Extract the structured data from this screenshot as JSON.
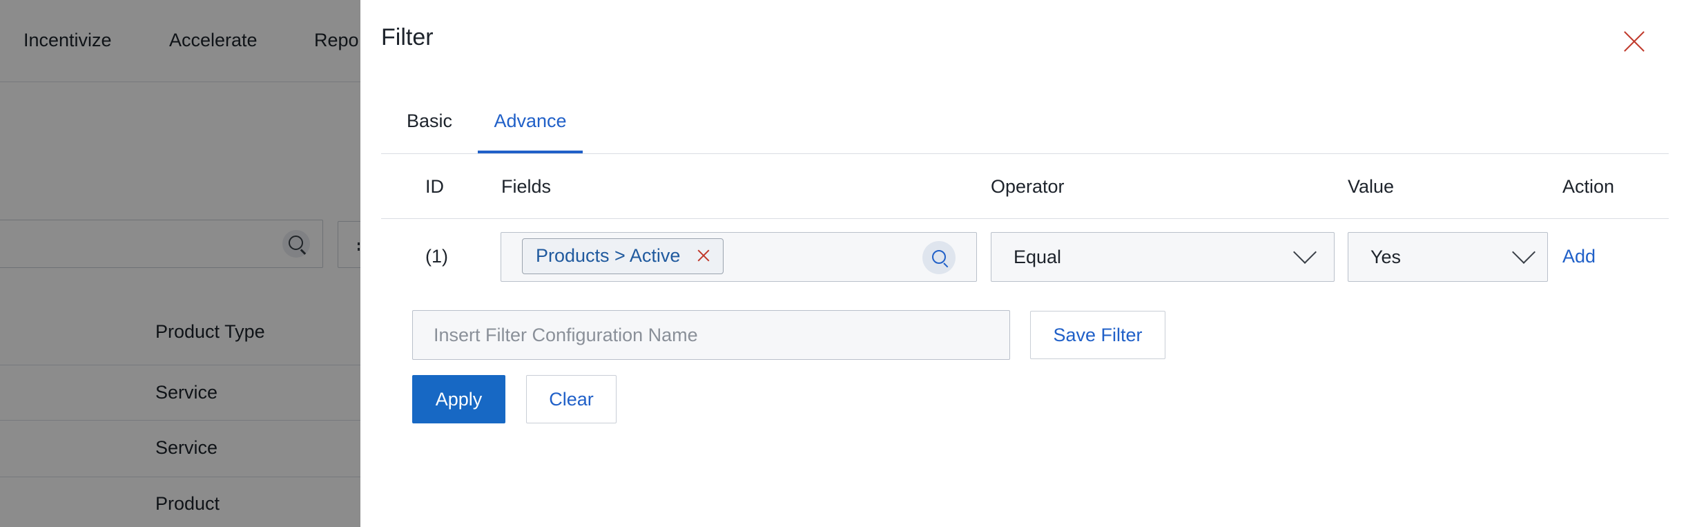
{
  "background": {
    "nav_items": [
      "Incentivize",
      "Accelerate",
      "Repo"
    ],
    "column_header": "Product Type",
    "rows": [
      "Service",
      "Service",
      "Product"
    ]
  },
  "drawer": {
    "title": "Filter",
    "tabs": [
      {
        "label": "Basic",
        "active": false
      },
      {
        "label": "Advance",
        "active": true
      }
    ],
    "table_headers": {
      "id": "ID",
      "fields": "Fields",
      "operator": "Operator",
      "value": "Value",
      "action": "Action"
    },
    "row": {
      "id": "(1)",
      "field_chip": "Products > Active",
      "operator": "Equal",
      "value": "Yes",
      "action": "Add"
    },
    "filter_name": {
      "value": "",
      "placeholder": "Insert Filter Configuration Name"
    },
    "buttons": {
      "save": "Save Filter",
      "apply": "Apply",
      "clear": "Clear"
    }
  },
  "colors": {
    "accent": "#2060c8",
    "primary_button": "#1768c4",
    "close": "#c0392b"
  }
}
